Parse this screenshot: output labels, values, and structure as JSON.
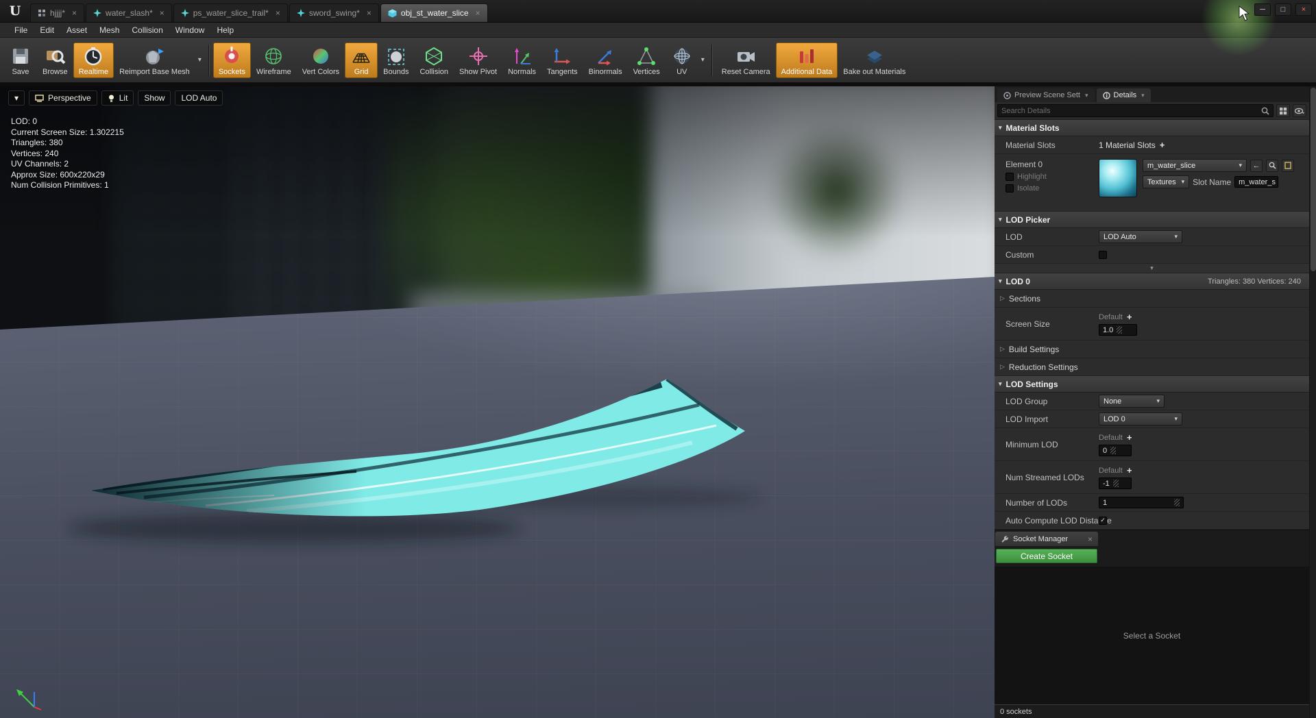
{
  "glyphs": {
    "caret_down": "▾",
    "tri_right": "▷",
    "check": "✓",
    "close": "×",
    "plus": "+",
    "arrow_left": "←",
    "minimize": "─",
    "maximize": "□",
    "close_window": "×"
  },
  "titlebar": {
    "logo": "U",
    "tabs": [
      {
        "label": "hjjjj*"
      },
      {
        "label": "water_slash*"
      },
      {
        "label": "ps_water_slice_trail*"
      },
      {
        "label": "sword_swing*"
      },
      {
        "label": "obj_st_water_slice",
        "active": true
      }
    ]
  },
  "menubar": {
    "items": [
      "File",
      "Edit",
      "Asset",
      "Mesh",
      "Collision",
      "Window",
      "Help"
    ]
  },
  "toolbar": {
    "buttons": [
      {
        "label": "Save"
      },
      {
        "label": "Browse"
      },
      {
        "label": "Realtime",
        "active": true
      },
      {
        "label": "Reimport Base Mesh",
        "has_dropdown": true
      },
      {
        "label": "Sockets",
        "active": true
      },
      {
        "label": "Wireframe"
      },
      {
        "label": "Vert Colors"
      },
      {
        "label": "Grid",
        "active": true
      },
      {
        "label": "Bounds"
      },
      {
        "label": "Collision"
      },
      {
        "label": "Show Pivot"
      },
      {
        "label": "Normals"
      },
      {
        "label": "Tangents"
      },
      {
        "label": "Binormals"
      },
      {
        "label": "Vertices"
      },
      {
        "label": "UV",
        "has_dropdown": true
      },
      {
        "label": "Reset Camera"
      },
      {
        "label": "Additional Data",
        "active": true
      },
      {
        "label": "Bake out Materials"
      }
    ]
  },
  "viewport": {
    "toolbar": {
      "perspective": "Perspective",
      "lit": "Lit",
      "show": "Show",
      "lod": "LOD Auto"
    },
    "stats": {
      "lod": "LOD:  0",
      "screen_size": "Current Screen Size:  1.302215",
      "triangles": "Triangles:  380",
      "vertices": "Vertices:  240",
      "uv_channels": "UV Channels:  2",
      "approx_size": "Approx Size:  600x220x29",
      "collision_primitives": "Num Collision Primitives:  1"
    }
  },
  "details": {
    "tabs": [
      {
        "label": "Preview Scene Sett"
      },
      {
        "label": "Details",
        "active": true
      }
    ],
    "search_placeholder": "Search Details",
    "material_slots": {
      "header": "Material Slots",
      "slots_label": "Material Slots",
      "slots_value": "1 Material Slots",
      "element_label": "Element 0",
      "material_name": "m_water_slice",
      "textures_label": "Textures",
      "slot_name_label": "Slot Name",
      "slot_name_value": "m_water_s",
      "highlight_label": "Highlight",
      "isolate_label": "Isolate"
    },
    "lod_picker": {
      "header": "LOD Picker",
      "lod_label": "LOD",
      "lod_value": "LOD Auto",
      "custom_label": "Custom"
    },
    "lod0": {
      "header": "LOD 0",
      "header_stats": "Triangles: 380   Vertices: 240",
      "sections_label": "Sections",
      "screen_size_label": "Screen Size",
      "default_label": "Default",
      "screen_size_value": "1.0",
      "build_settings_label": "Build Settings",
      "reduction_settings_label": "Reduction Settings"
    },
    "lod_settings": {
      "header": "LOD Settings",
      "lod_group_label": "LOD Group",
      "lod_group_value": "None",
      "lod_import_label": "LOD Import",
      "lod_import_value": "LOD 0",
      "minimum_lod_label": "Minimum LOD",
      "default_label": "Default",
      "minimum_lod_value": "0",
      "num_streamed_label": "Num Streamed LODs",
      "num_streamed_value": "-1",
      "number_of_lods_label": "Number of LODs",
      "number_of_lods_value": "1",
      "auto_compute_label": "Auto Compute LOD Distance"
    }
  },
  "socket_manager": {
    "title": "Socket Manager",
    "create_label": "Create Socket",
    "empty_text": "Select a Socket",
    "footer": "0 sockets"
  }
}
